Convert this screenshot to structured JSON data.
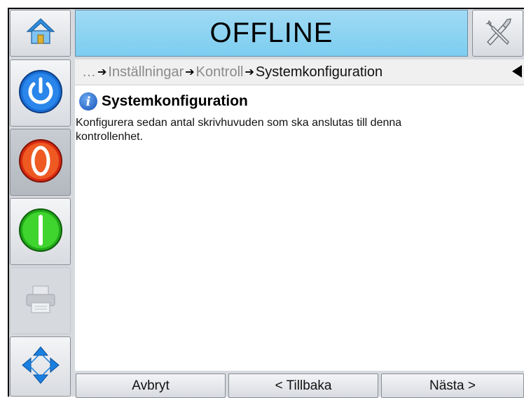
{
  "header": {
    "status": "OFFLINE",
    "home_icon": "home-icon",
    "tools_icon": "tools-icon"
  },
  "sidebar": {
    "items": [
      {
        "name": "power",
        "icon": "power-icon",
        "color": "#1a6fd6"
      },
      {
        "name": "stop",
        "icon": "stop-icon",
        "color": "#e8421a"
      },
      {
        "name": "start",
        "icon": "start-icon",
        "color": "#2ec21e"
      },
      {
        "name": "print",
        "icon": "printer-icon"
      },
      {
        "name": "navigate",
        "icon": "navigation-arrows-icon",
        "color": "#1b7fe0"
      }
    ]
  },
  "breadcrumb": {
    "ellipsis": "…",
    "items": [
      "Inställningar",
      "Kontroll"
    ],
    "current": "Systemkonfiguration"
  },
  "main": {
    "title": "Systemkonfiguration",
    "description": "Konfigurera sedan antal skrivhuvuden som ska anslutas till denna kontrollenhet."
  },
  "footer": {
    "cancel": "Avbryt",
    "back": "< Tillbaka",
    "next": "Nästa >"
  }
}
